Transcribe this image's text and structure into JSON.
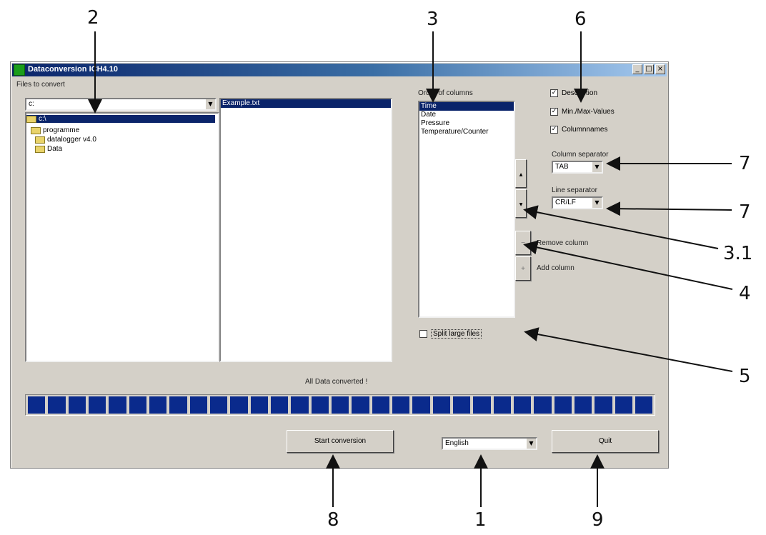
{
  "window": {
    "title": "Dataconversion ICH4.10",
    "controls": [
      "_",
      "□",
      "×"
    ]
  },
  "files_to_convert": {
    "label": "Files to convert",
    "drive": "c:",
    "tree": [
      "c:\\",
      "programme",
      "datalogger v4.0",
      "Data"
    ],
    "files": [
      "Example.txt"
    ]
  },
  "order_of_columns": {
    "label": "Order of columns",
    "items": [
      "Time",
      "Date",
      "Pressure",
      "Temperature/Counter"
    ],
    "selected": "Time"
  },
  "move_buttons": {
    "up": "▲",
    "down": "▼"
  },
  "remove_column": {
    "icon": "−",
    "label": "Remove column"
  },
  "add_column": {
    "icon": "+",
    "label": "Add column"
  },
  "options": [
    {
      "label": "Description",
      "checked": true
    },
    {
      "label": "Min./Max-Values",
      "checked": true
    },
    {
      "label": "Columnnames",
      "checked": true
    }
  ],
  "column_separator": {
    "label": "Column separator",
    "value": "TAB"
  },
  "line_separator": {
    "label": "Line separator",
    "value": "CR/LF"
  },
  "split_large_files": {
    "label": "Split large files",
    "checked": false
  },
  "status": {
    "text": "All Data converted !"
  },
  "progress": {
    "segments": 31,
    "fraction": 1.0
  },
  "start_button": {
    "label": "Start conversion"
  },
  "language": {
    "value": "English"
  },
  "quit_button": {
    "label": "Quit"
  },
  "callouts": {
    "c1": "1",
    "c2": "2",
    "c3": "3",
    "c31": "3.1",
    "c4": "4",
    "c5": "5",
    "c6": "6",
    "c7a": "7",
    "c7b": "7",
    "c8": "8",
    "c9": "9"
  }
}
